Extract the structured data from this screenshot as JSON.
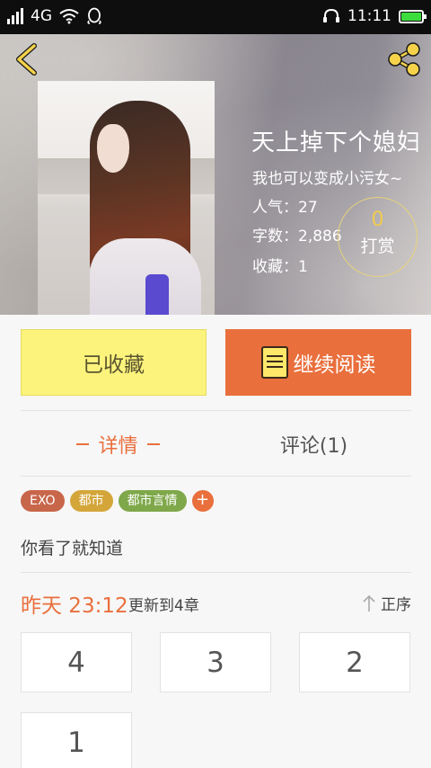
{
  "status_bar": {
    "network": "4G",
    "time": "11:11"
  },
  "header": {
    "book_title": "天上掉下个媳妇",
    "book_subtitle": "我也可以变成小污女~",
    "stats": [
      {
        "label": "人气：",
        "value": "27"
      },
      {
        "label": "字数：",
        "value": "2,886"
      },
      {
        "label": "收藏：",
        "value": "1"
      }
    ],
    "tip": {
      "count": "0",
      "label": "打赏"
    }
  },
  "actions": {
    "favorite_label": "已收藏",
    "continue_label": "继续阅读"
  },
  "tabs": [
    {
      "label": "详情"
    },
    {
      "label": "评论(1)"
    }
  ],
  "tags": [
    {
      "label": "EXO",
      "color": "#c8664a"
    },
    {
      "label": "都市",
      "color": "#d4a63a"
    },
    {
      "label": "都市言情",
      "color": "#7fa84a"
    }
  ],
  "tag_add_label": "+",
  "description": "你看了就知道",
  "update": {
    "time": "昨天 23:12",
    "text": "更新到4章",
    "sort_label": "正序"
  },
  "chapters": [
    "4",
    "3",
    "2",
    "1"
  ],
  "colors": {
    "accent": "#e96f3c",
    "favorite_bg": "#fcf37c",
    "tip_gold": "#f2cb50"
  },
  "icons": {
    "back": "back-arrow-icon",
    "share": "share-icon",
    "read": "book-icon",
    "sort": "arrow-up-icon"
  }
}
